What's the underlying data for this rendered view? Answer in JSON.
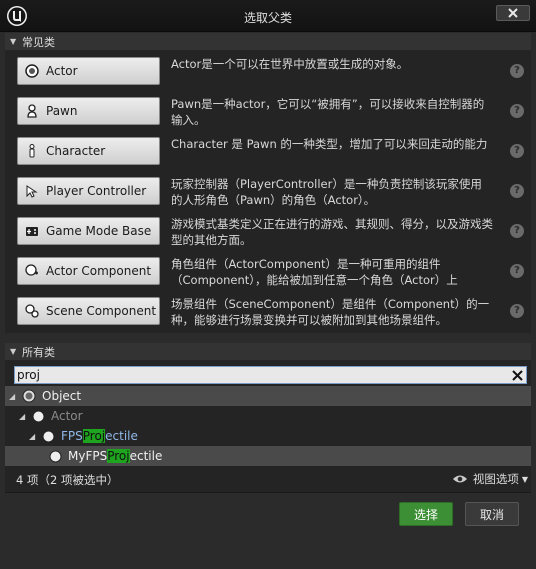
{
  "window": {
    "title": "选取父类"
  },
  "common": {
    "header": "常见类",
    "items": [
      {
        "label": "Actor",
        "icon": "actor-icon",
        "desc": "Actor是一个可以在世界中放置或生成的对象。"
      },
      {
        "label": "Pawn",
        "icon": "pawn-icon",
        "desc": "Pawn是一种actor，它可以“被拥有”，可以接收来自控制器的输入。"
      },
      {
        "label": "Character",
        "icon": "character-icon",
        "desc": "Character 是 Pawn 的一种类型，增加了可以来回走动的能力"
      },
      {
        "label": "Player Controller",
        "icon": "player-controller-icon",
        "desc": "玩家控制器（PlayerController）是一种负责控制该玩家使用的人形角色（Pawn）的角色（Actor）。"
      },
      {
        "label": "Game Mode Base",
        "icon": "game-mode-icon",
        "desc": "游戏模式基类定义正在进行的游戏、其规则、得分，以及游戏类型的其他方面。"
      },
      {
        "label": "Actor Component",
        "icon": "actor-component-icon",
        "desc": "角色组件（ActorComponent）是一种可重用的组件（Component），能给被加到任意一个角色（Actor）上"
      },
      {
        "label": "Scene Component",
        "icon": "scene-component-icon",
        "desc": "场景组件（SceneComponent）是组件（Component）的一种，能够进行场景变换并可以被附加到其他场景组件。"
      }
    ]
  },
  "all": {
    "header": "所有类",
    "search_value": "proj",
    "tree": [
      {
        "pre": "Object",
        "match": "",
        "post": ""
      },
      {
        "pre": "Actor",
        "match": "",
        "post": ""
      },
      {
        "pre": "FPS",
        "match": "Proj",
        "post": "ectile"
      },
      {
        "pre": "MyFPS",
        "match": "Proj",
        "post": "ectile"
      }
    ],
    "status": "4 项（2 项被选中）",
    "view_options": "视图选项"
  },
  "buttons": {
    "select": "选择",
    "cancel": "取消"
  },
  "colors": {
    "accent_green": "#3d8f35",
    "highlight_green": "#1ea41e",
    "selected_row": "#4a4a4a"
  }
}
